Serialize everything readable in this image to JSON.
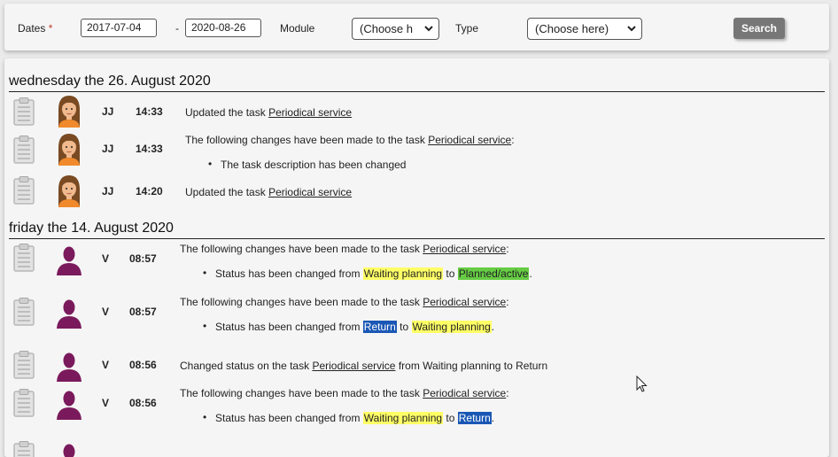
{
  "filters": {
    "dates_label": "Dates",
    "required_mark": "*",
    "date_from": "2017-07-04",
    "date_sep": "-",
    "date_to": "2020-08-26",
    "module_label": "Module",
    "module_value": "(Choose h",
    "type_label": "Type",
    "type_value": "(Choose here)",
    "search_label": "Search"
  },
  "days": [
    {
      "header": "wednesday the 26. August 2020",
      "entries": [
        {
          "initials": "JJ",
          "time": "14:33",
          "prefix": "Updated the task ",
          "link": "Periodical service"
        },
        {
          "initials": "JJ",
          "time": "14:33",
          "prefix": "The following changes have been made to the task ",
          "link": "Periodical service",
          "suffix": ":",
          "bullet": "The task description has been changed"
        },
        {
          "initials": "JJ",
          "time": "14:20",
          "prefix": "Updated the task ",
          "link": "Periodical service"
        }
      ]
    },
    {
      "header": "friday the 14. August 2020",
      "entries": [
        {
          "initials": "V",
          "time": "08:57",
          "prefix": "The following changes have been made to the task ",
          "link": "Periodical service",
          "suffix": ":",
          "bullet_prefix": "Status has been changed from ",
          "from": "Waiting planning",
          "to_word": " to ",
          "to": "Planned/active",
          "end": "."
        },
        {
          "initials": "V",
          "time": "08:57",
          "prefix": "The following changes have been made to the task ",
          "link": "Periodical service",
          "suffix": ":",
          "bullet_prefix": "Status has been changed from ",
          "from": "Return",
          "to_word": " to ",
          "to": "Waiting planning",
          "end": "."
        },
        {
          "initials": "V",
          "time": "08:56",
          "prefix": "Changed status on the task ",
          "link": "Periodical service",
          "suffix": " from Waiting planning to Return"
        },
        {
          "initials": "V",
          "time": "08:56",
          "prefix": "The following changes have been made to the task ",
          "link": "Periodical service",
          "suffix": ":",
          "bullet_prefix": "Status has been changed from ",
          "from": "Waiting planning",
          "to_word": " to ",
          "to": "Return",
          "end": "."
        }
      ]
    }
  ],
  "icons": {
    "clipboard": "clipboard-icon",
    "avatar_female": "female-avatar-icon",
    "avatar_user": "user-silhouette-icon",
    "cursor": "mouse-cursor-icon",
    "dropdown": "chevron-down-icon"
  },
  "colors": {
    "highlight_waiting": "#ffff66",
    "highlight_planned": "#66cc44",
    "highlight_return": "#1a57b5",
    "user_icon": "#7a1a5c"
  }
}
